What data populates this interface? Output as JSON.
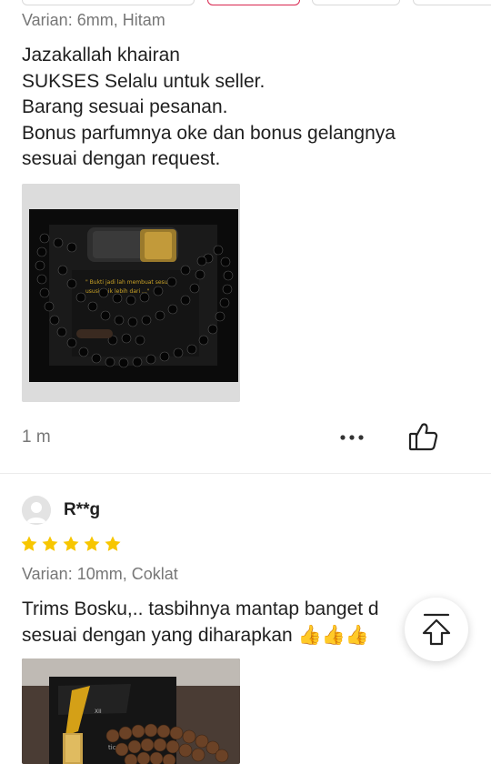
{
  "review_1": {
    "variant": "Varian: 6mm, Hitam",
    "text_lines": [
      "Jazakallah khairan",
      "SUKSES Selalu untuk seller.",
      "Barang sesuai pesanan.",
      "Bonus parfumnya oke dan bonus gelangnya",
      "sesuai dengan request."
    ],
    "time": "1 m",
    "photo": "photo of prayer beads and perfume bottle in black box"
  },
  "review_2": {
    "username": "R**g",
    "rating": 5,
    "variant": "Varian: 10mm, Coklat",
    "text_lines": [
      "Trims Bosku,.. tasbihnya mantap banget d",
      "sesuai dengan yang diharapkan 👍👍👍"
    ],
    "photo": "photo of wooden prayer beads with perfume box"
  },
  "icons": {
    "more": "more-dots-icon",
    "like": "thumbs-up-icon",
    "back_to_top": "arrow-up-to-top-icon",
    "avatar": "default-avatar-icon",
    "star": "star-icon"
  },
  "colors": {
    "star": "#f7c600",
    "active_chip_border": "#d9264f",
    "secondary_text": "#777777"
  }
}
